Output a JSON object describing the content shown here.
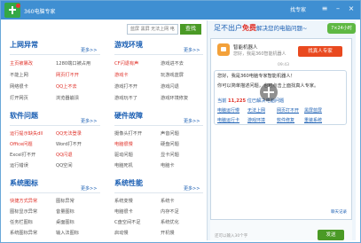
{
  "window": {
    "title": "360电脑专家",
    "expert_link": "找专家",
    "menu_icon": "menu-icon",
    "minimize_icon": "minimize-icon",
    "close_icon": "close-icon"
  },
  "search": {
    "placeholder": "蓝屏 黑屏 无法上网 电脑很卡 开机慢",
    "button": "查找"
  },
  "sections": {
    "internet": {
      "title": "上网异常",
      "more": "更多>>",
      "items": [
        "主页被篡改",
        "1280端口被占用",
        "不能上网",
        "网页打不开",
        "网络很卡",
        "QQ上不去",
        "打开网页",
        "浏览器崩溃"
      ]
    },
    "game": {
      "title": "游戏环境",
      "more": "更多>>",
      "items": [
        "CF闪退有声",
        "游戏进不去",
        "游戏卡",
        "玩游戏蓝屏",
        "游戏打不开",
        "游戏闪退",
        "游戏玩不了",
        "游戏环境修复"
      ]
    },
    "software": {
      "title": "软件问题",
      "more": "更多>>",
      "items": [
        "运行提示缺失dll",
        "QQ无法登录",
        "Office问题",
        "Word打不开",
        "Excel打不开",
        "QQ闪退",
        "运行错误",
        "QQ空间"
      ]
    },
    "hardware": {
      "title": "硬件故障",
      "more": "更多>>",
      "items": [
        "摄像头打不开",
        "声音问题",
        "电脑很慢",
        "硬盘问题",
        "驱动问题",
        "显卡问题",
        "电脑死机",
        "电脑卡"
      ]
    },
    "icons": {
      "title": "系统图标",
      "more": "更多>>",
      "items": [
        "快捷方式异常",
        "图标异常",
        "图标显示异常",
        "音量图标",
        "任务栏图标",
        "桌面图标",
        "系统图标异常",
        "输入法图标"
      ]
    },
    "performance": {
      "title": "系统性能",
      "more": "更多>>",
      "items": [
        "系统变慢",
        "系统卡",
        "电脑很卡",
        "内存不足",
        "C盘空间不足",
        "系统优化",
        "启动慢",
        "开机慢"
      ]
    }
  },
  "promo": {
    "prefix": "足不出户",
    "highlight": "免费",
    "suffix": "解决您的电脑问题~",
    "badge": "7×24小时"
  },
  "chat": {
    "robot_name": "智能机器人",
    "robot_desc": "您好，我是360智能机器人",
    "ask_expert": "找真人专家",
    "time": "09:43",
    "greeting": "您好，我是360电脑专家智能机器人！",
    "hint": "你可以简单描述问题，也可点击上面找真人专家。",
    "solved_prefix": "当前",
    "solved_count": "11,225",
    "solved_suffix": "位已解决电脑问题",
    "topics": [
      "电脑运行慢",
      "无法上网",
      "网页打不开",
      "黑屏蓝屏",
      "电脑运行卡",
      "游戏环境",
      "软件修复",
      "重装系统"
    ],
    "history": "聊天记录",
    "input_hint": "还可以输入30个字",
    "send": "发送"
  },
  "colors": {
    "title_bar": "#3f8fd2",
    "heading": "#1b5fb3",
    "highlight_red": "#e0322a",
    "button_green": "#4a9a25",
    "expert_orange": "#e9491f"
  }
}
